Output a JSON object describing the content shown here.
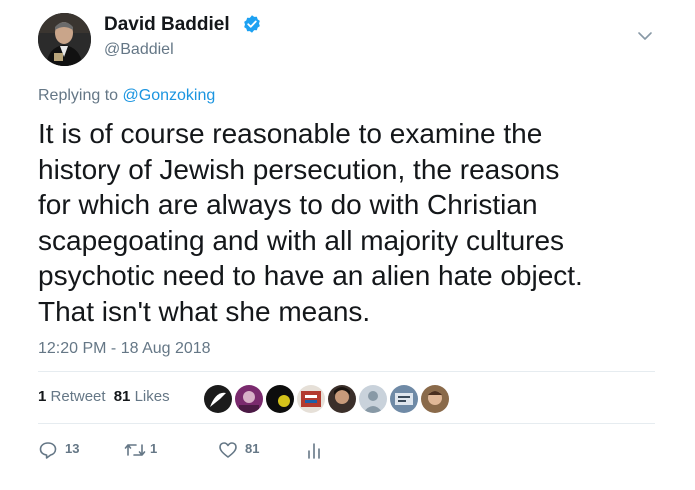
{
  "author": {
    "display_name": "David Baddiel",
    "handle": "@Baddiel",
    "avatar_icon": "person-photo-icon",
    "verified_color": "#1da1f2"
  },
  "reply": {
    "prefix": "Replying to",
    "mention": "@Gonzoking"
  },
  "tweet": {
    "lines": [
      "It is of course reasonable to examine the",
      "history of Jewish persecution, the reasons",
      "for which are always to do with Christian",
      "scapegoating and with all majority cultures",
      "psychotic need to have an alien hate object.",
      "That isn't what she means."
    ],
    "timestamp": "12:20 PM - 18 Aug 2018"
  },
  "stats": {
    "retweets_count": "1",
    "retweets_label": "Retweet",
    "likes_count": "81",
    "likes_label": "Likes"
  },
  "likers": [
    {
      "icon": "avatar-icon",
      "color": "#1b1b1b"
    },
    {
      "icon": "avatar-icon",
      "color": "#7a2a6e"
    },
    {
      "icon": "avatar-icon",
      "color": "#3a3a20"
    },
    {
      "icon": "avatar-icon",
      "color": "#b33a2e"
    },
    {
      "icon": "avatar-icon",
      "color": "#3b2f2a"
    },
    {
      "icon": "avatar-icon",
      "color": "#c9d2db"
    },
    {
      "icon": "avatar-icon",
      "color": "#6f8aa6"
    },
    {
      "icon": "avatar-icon",
      "color": "#8a6a4a"
    }
  ],
  "actions": {
    "reply_count": "13",
    "retweet_count": "1",
    "like_count": "81",
    "icon_color": "#657786"
  }
}
